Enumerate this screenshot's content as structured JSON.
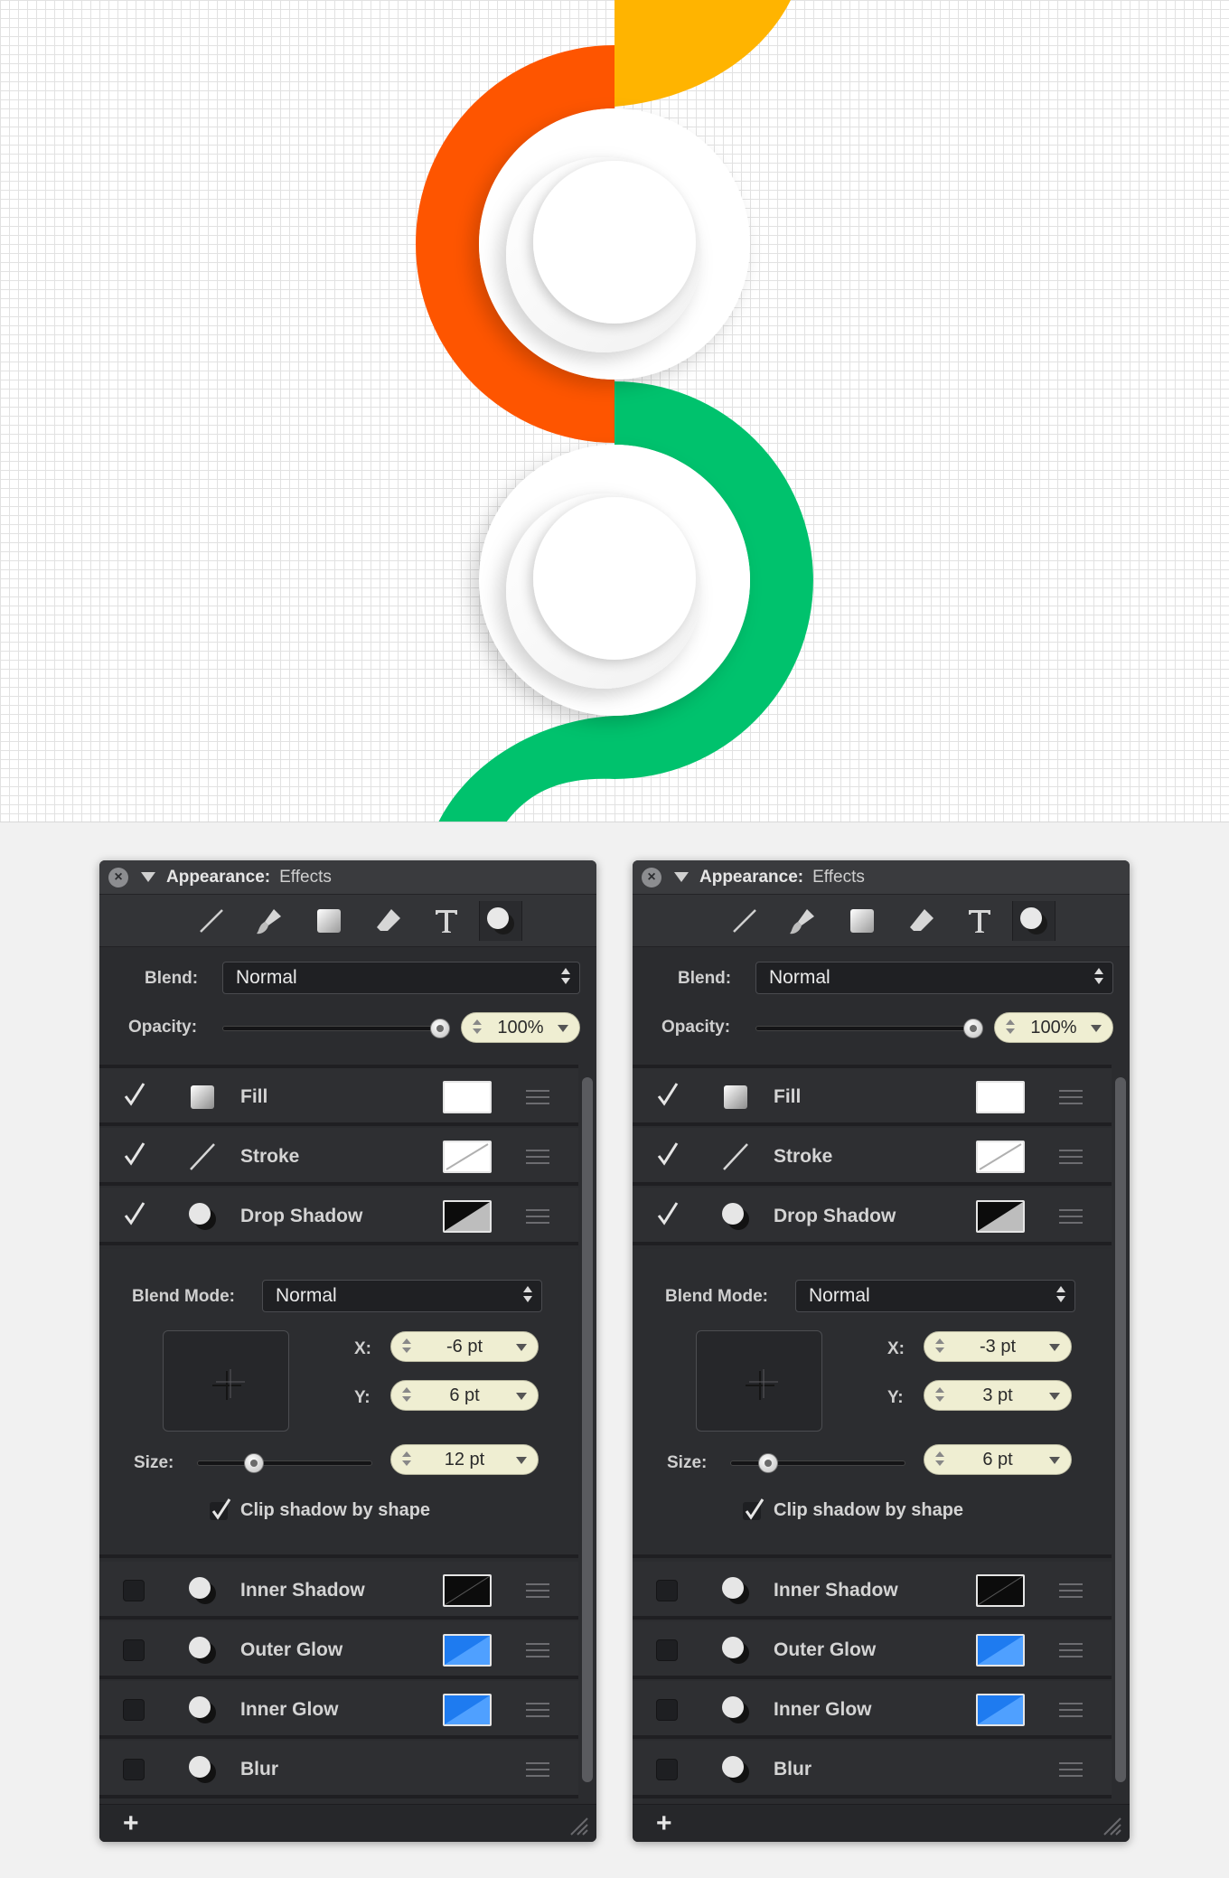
{
  "canvas": {
    "colors": {
      "orange": "#fe5500",
      "yellow": "#ffb400",
      "green": "#00c26d",
      "grid": "#e2e2e2",
      "white": "#ffffff"
    }
  },
  "panels": [
    {
      "title": "Appearance:",
      "subtitle": "Effects",
      "toolbar_icons": [
        "line-tool-icon",
        "brush-tool-icon",
        "rect-fill-icon",
        "eraser-icon",
        "text-tool-icon",
        "effects-icon"
      ],
      "blend_label": "Blend:",
      "blend_value": "Normal",
      "opacity_label": "Opacity:",
      "opacity_value": "100%",
      "opacity_level": 1.0,
      "effects_top": [
        {
          "label": "Fill",
          "checked": true,
          "swatch": "#ffffff",
          "icon": "fill-icon"
        },
        {
          "label": "Stroke",
          "checked": true,
          "swatch": "stroke-white",
          "icon": "stroke-icon"
        },
        {
          "label": "Drop Shadow",
          "checked": true,
          "swatch": "shadow-black",
          "icon": "shadow-icon"
        }
      ],
      "shadow": {
        "blend_mode_label": "Blend Mode:",
        "blend_mode_value": "Normal",
        "x_label": "X:",
        "x_value": "-6 pt",
        "y_label": "Y:",
        "y_value": "6 pt",
        "size_label": "Size:",
        "size_value": "12 pt",
        "size_level": 0.27,
        "clip_label": "Clip shadow by shape",
        "clip_checked": true
      },
      "effects_bottom": [
        {
          "label": "Inner Shadow",
          "checked": false,
          "swatch": "#000000"
        },
        {
          "label": "Outer Glow",
          "checked": false,
          "swatch": "#1e7bf0"
        },
        {
          "label": "Inner Glow",
          "checked": false,
          "swatch": "#1e7bf0"
        },
        {
          "label": "Blur",
          "checked": false,
          "swatch": ""
        }
      ],
      "add_label": "+"
    },
    {
      "title": "Appearance:",
      "subtitle": "Effects",
      "toolbar_icons": [
        "line-tool-icon",
        "brush-tool-icon",
        "rect-fill-icon",
        "eraser-icon",
        "text-tool-icon",
        "effects-icon"
      ],
      "blend_label": "Blend:",
      "blend_value": "Normal",
      "opacity_label": "Opacity:",
      "opacity_value": "100%",
      "opacity_level": 1.0,
      "effects_top": [
        {
          "label": "Fill",
          "checked": true,
          "swatch": "#ffffff",
          "icon": "fill-icon"
        },
        {
          "label": "Stroke",
          "checked": true,
          "swatch": "stroke-white",
          "icon": "stroke-icon"
        },
        {
          "label": "Drop Shadow",
          "checked": true,
          "swatch": "shadow-black",
          "icon": "shadow-icon"
        }
      ],
      "shadow": {
        "blend_mode_label": "Blend Mode:",
        "blend_mode_value": "Normal",
        "x_label": "X:",
        "x_value": "-3 pt",
        "y_label": "Y:",
        "y_value": "3 pt",
        "size_label": "Size:",
        "size_value": "6 pt",
        "size_level": 0.16,
        "clip_label": "Clip shadow by shape",
        "clip_checked": true
      },
      "effects_bottom": [
        {
          "label": "Inner Shadow",
          "checked": false,
          "swatch": "#000000"
        },
        {
          "label": "Outer Glow",
          "checked": false,
          "swatch": "#1e7bf0"
        },
        {
          "label": "Inner Glow",
          "checked": false,
          "swatch": "#1e7bf0"
        },
        {
          "label": "Blur",
          "checked": false,
          "swatch": ""
        }
      ],
      "add_label": "+"
    }
  ]
}
